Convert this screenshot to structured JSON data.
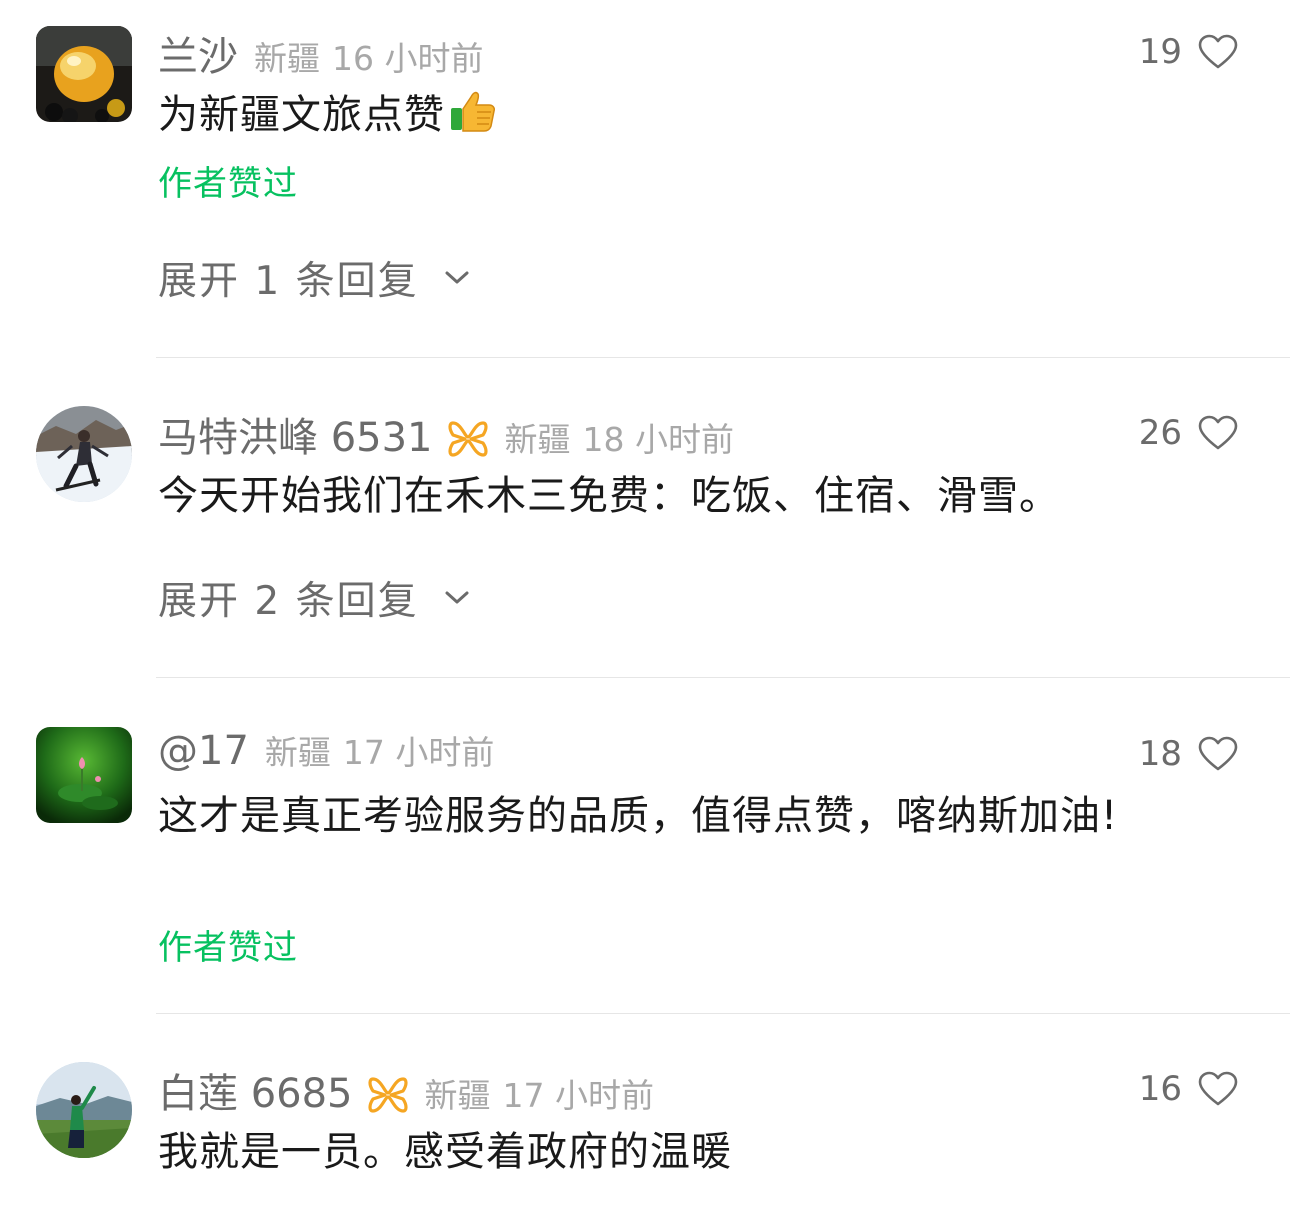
{
  "colors": {
    "accent_green": "#07c160",
    "muted_text": "#6b6b6b",
    "light_text": "#a8a8a8",
    "badge_orange": "#f5a623"
  },
  "comments": [
    {
      "username": "兰沙",
      "region": "新疆",
      "time": "16 小时前",
      "likes": "19",
      "content": "为新疆文旅点赞",
      "emoji": "thumbs-up-icon",
      "author_liked": "作者赞过",
      "expand_label": "展开 1 条回复"
    },
    {
      "username": "马特洪峰 6531",
      "badge": "orange-ribbon-badge-icon",
      "region": "新疆",
      "time": "18 小时前",
      "likes": "26",
      "content": "今天开始我们在禾木三免费：吃饭、住宿、滑雪。",
      "expand_label": "展开 2 条回复"
    },
    {
      "username": "@17",
      "region": "新疆",
      "time": "17 小时前",
      "likes": "18",
      "content": "这才是真正考验服务的品质，值得点赞，喀纳斯加油!",
      "author_liked": "作者赞过"
    },
    {
      "username": "白莲 6685",
      "badge": "orange-ribbon-badge-icon",
      "region": "新疆",
      "time": "17 小时前",
      "likes": "16",
      "content": "我就是一员。感受着政府的温暖"
    }
  ]
}
